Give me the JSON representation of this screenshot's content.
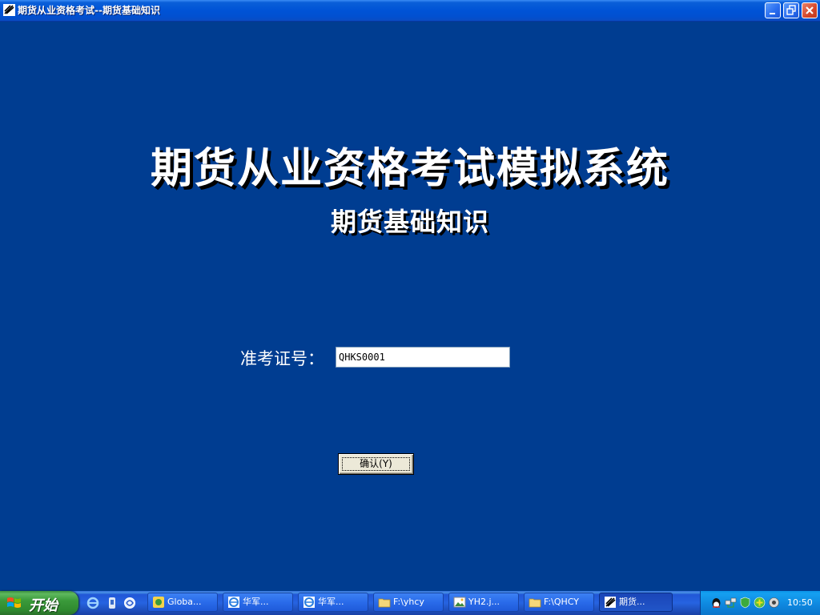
{
  "window": {
    "title": "期货从业资格考试--期货基础知识"
  },
  "main": {
    "title": "期货从业资格考试模拟系统",
    "subtitle": "期货基础知识",
    "id_label": "准考证号：",
    "id_value": "QHKS0001",
    "confirm_label": "确认(Y)"
  },
  "taskbar": {
    "start_label": "开始",
    "quick_launch": [
      "ie-icon",
      "media-icon",
      "browser-icon"
    ],
    "buttons": [
      {
        "label": "Globa...",
        "icon": "messenger-icon"
      },
      {
        "label": "华军...",
        "icon": "ie-icon"
      },
      {
        "label": "华军...",
        "icon": "ie-icon"
      },
      {
        "label": "F:\\yhcy",
        "icon": "folder-icon"
      },
      {
        "label": "YH2.j...",
        "icon": "image-icon"
      },
      {
        "label": "F:\\QHCY",
        "icon": "folder-icon"
      },
      {
        "label": "期货...",
        "icon": "app-icon",
        "active": true
      }
    ],
    "tray_icons": [
      "qq-icon",
      "network-icon",
      "shield-icon",
      "plus-icon",
      "volume-icon"
    ],
    "clock": "10:50"
  },
  "colors": {
    "background": "#003d91",
    "titlebar": "#0053d6",
    "taskbar": "#2663e0",
    "start": "#3a9a3a"
  }
}
